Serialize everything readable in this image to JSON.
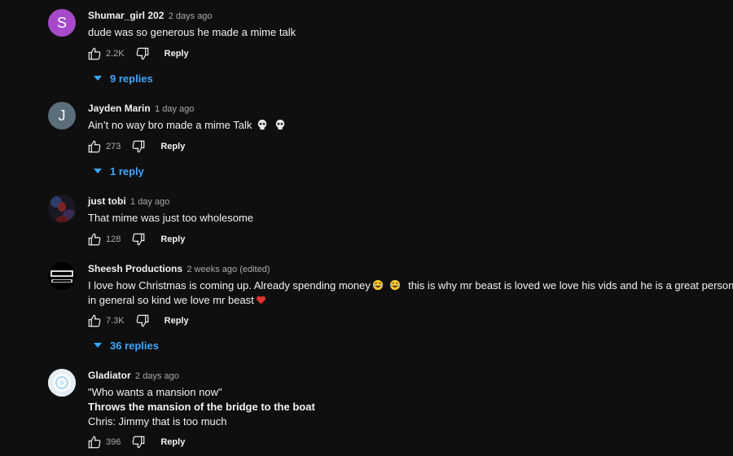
{
  "comments": [
    {
      "author": "Shumar_girl 202",
      "time": "2 days ago",
      "avatar_letter": "S",
      "avatar_color": "#a64ac9",
      "lines": [
        "dude was so generous he made a mime talk"
      ],
      "likes": "2.2K",
      "reply_label": "Reply",
      "replies_label": "9 replies"
    },
    {
      "author": "Jayden Marin",
      "time": "1 day ago",
      "avatar_letter": "J",
      "avatar_color": "#5b6e7a",
      "lines": [
        "Ain’t no way bro made a mime Talk"
      ],
      "likes": "273",
      "reply_label": "Reply",
      "replies_label": "1 reply"
    },
    {
      "author": "just tobi",
      "time": "1 day ago",
      "lines": [
        "That mime was just too wholesome"
      ],
      "likes": "128",
      "reply_label": "Reply"
    },
    {
      "author": "Sheesh Productions",
      "time": "2 weeks ago (edited)",
      "lines": [
        "I love how Christmas is coming up. Already spending money",
        "this is why mr beast is loved we love his vids and he is a great person",
        "in general so kind we love mr beast"
      ],
      "likes": "7.3K",
      "reply_label": "Reply",
      "replies_label": "36 replies"
    },
    {
      "author": "Gladiator",
      "time": "2 days ago",
      "lines": [
        "\"Who wants a mansion now\"",
        "Throws the mansion of the bridge to the boat",
        "Chris: Jimmy that is too much"
      ],
      "likes": "396",
      "reply_label": "Reply"
    }
  ],
  "colors": {
    "background": "#0f0f0f",
    "link": "#3ea6ff",
    "muted": "#aaaaaa"
  },
  "icons": [
    "thumb-up-icon",
    "thumb-down-icon",
    "chevron-down-icon",
    "skull-icon",
    "laughing-emoji-icon",
    "heart-icon"
  ]
}
